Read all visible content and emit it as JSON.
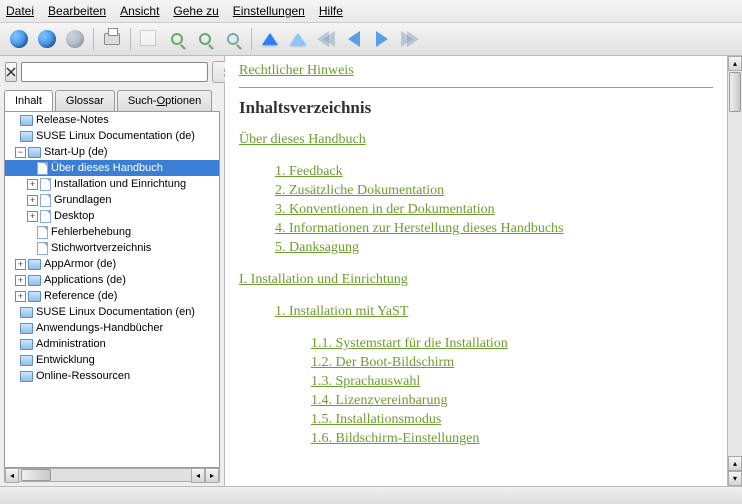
{
  "menu": {
    "file": "Datei",
    "edit": "Bearbeiten",
    "view": "Ansicht",
    "goto": "Gehe zu",
    "settings": "Einstellungen",
    "help": "Hilfe"
  },
  "search": {
    "placeholder": "",
    "button": "Suchen"
  },
  "tabs": {
    "content": "Inhalt",
    "glossary": "Glossar",
    "options": "Such-Optionen"
  },
  "tree": {
    "release": "Release-Notes",
    "suse_de": "SUSE Linux Documentation (de)",
    "startup": "Start-Up (de)",
    "about": "Über dieses Handbuch",
    "install": "Installation und Einrichtung",
    "basics": "Grundlagen",
    "desktop": "Desktop",
    "trouble": "Fehlerbehebung",
    "index": "Stichwortverzeichnis",
    "apparmor": "AppArmor (de)",
    "apps": "Applications (de)",
    "ref": "Reference (de)",
    "suse_en": "SUSE Linux Documentation (en)",
    "manuals": "Anwendungs-Handbücher",
    "admin": "Administration",
    "dev": "Entwicklung",
    "online": "Online-Ressourcen"
  },
  "doc": {
    "legal": "Rechtlicher Hinweis",
    "toc": "Inhaltsverzeichnis",
    "about": "Über dieses Handbuch",
    "s1": "1. Feedback",
    "s2": "2. Zusätzliche Dokumentation",
    "s3": "3. Konventionen in der Dokumentation",
    "s4": "4. Informationen zur Herstellung dieses Handbuchs",
    "s5": "5. Danksagung",
    "part1": "I. Installation und Einrichtung",
    "ch1": "1. Installation mit YaST",
    "c11": "1.1. Systemstart für die Installation",
    "c12": "1.2. Der Boot-Bildschirm",
    "c13": "1.3. Sprachauswahl",
    "c14": "1.4. Lizenzvereinbarung",
    "c15": "1.5. Installationsmodus",
    "c16": "1.6. Bildschirm-Einstellungen"
  }
}
